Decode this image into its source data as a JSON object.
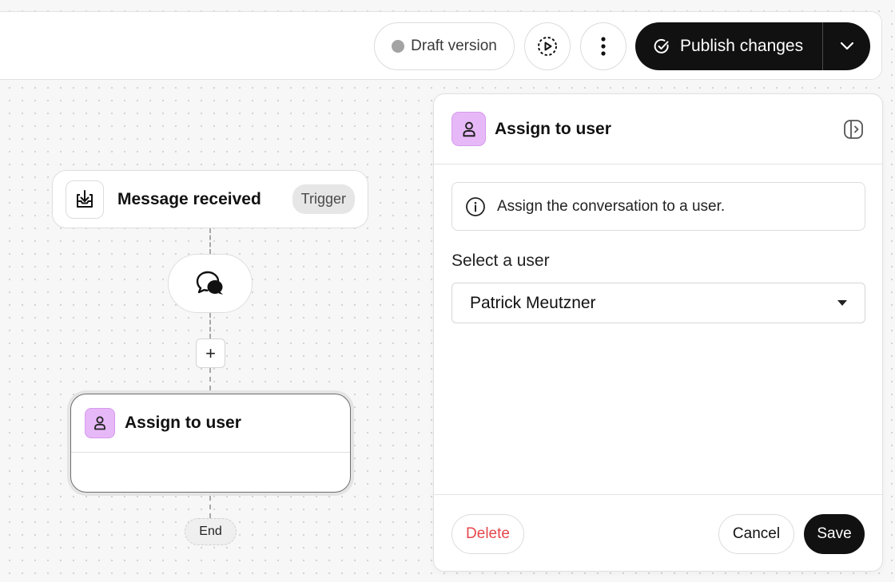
{
  "toolbar": {
    "draft_label": "Draft version",
    "publish_label": "Publish changes"
  },
  "flow": {
    "trigger": {
      "title": "Message received",
      "badge": "Trigger"
    },
    "add_step_label": "+",
    "assign_node": {
      "title": "Assign to user"
    },
    "end_label": "End"
  },
  "panel": {
    "title": "Assign to user",
    "info_text": "Assign the conversation to a user.",
    "select_label": "Select a user",
    "selected_user": "Patrick Meutzner",
    "delete_label": "Delete",
    "cancel_label": "Cancel",
    "save_label": "Save"
  },
  "colors": {
    "accent_dark": "#111111",
    "user_badge": "#e7b8f7",
    "delete_red": "#e5484d",
    "draft_dot": "#a3a3a3"
  },
  "icons": {
    "draft_status": "status-dot-icon",
    "preview": "play-circle-icon",
    "more": "more-vertical-icon",
    "publish": "check-circle-icon",
    "publish_menu": "chevron-down-icon",
    "trigger": "inbox-download-icon",
    "chat": "chat-bubbles-icon",
    "user": "user-icon",
    "collapse_panel": "sidebar-collapse-icon",
    "info": "info-icon",
    "select_caret": "caret-down-icon"
  }
}
